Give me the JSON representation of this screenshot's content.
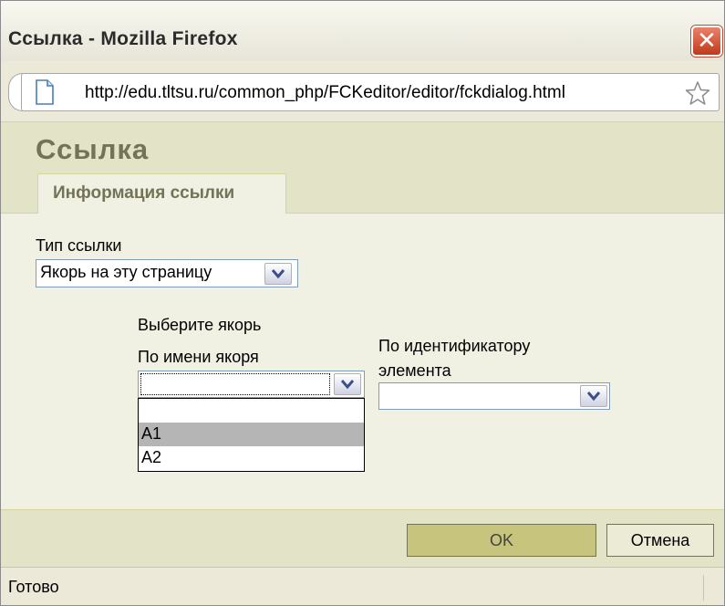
{
  "window": {
    "title": "Ссылка - Mozilla Firefox",
    "close_symbol": "✕"
  },
  "urlbar": {
    "url": "http://edu.tltsu.ru/common_php/FCKeditor/editor/fckdialog.html",
    "icons": [
      "page-icon",
      "bookmark-star-icon"
    ]
  },
  "dialog": {
    "title": "Ссылка",
    "tabs": [
      {
        "label": "Информация ссылки",
        "active": true
      }
    ],
    "link_type": {
      "label": "Тип ссылки",
      "selected": "Якорь на эту страницу"
    },
    "anchor": {
      "heading": "Выберите якорь",
      "by_name": {
        "label": "По имени якоря",
        "selected": "",
        "options": [
          "",
          "A1",
          "A2"
        ],
        "highlighted": "A1",
        "expanded": true
      },
      "by_id": {
        "label_line1": "По идентификатору",
        "label_line2": "элемента",
        "selected": ""
      }
    },
    "buttons": {
      "ok": "OK",
      "cancel": "Отмена"
    }
  },
  "statusbar": {
    "text": "Готово"
  },
  "colors": {
    "dialog_bg": "#f1f1e3",
    "dialog_header": "#e3e3c7",
    "title_color": "#737357",
    "ok_button": "#c6c47d",
    "close_button": "#c1391a"
  }
}
